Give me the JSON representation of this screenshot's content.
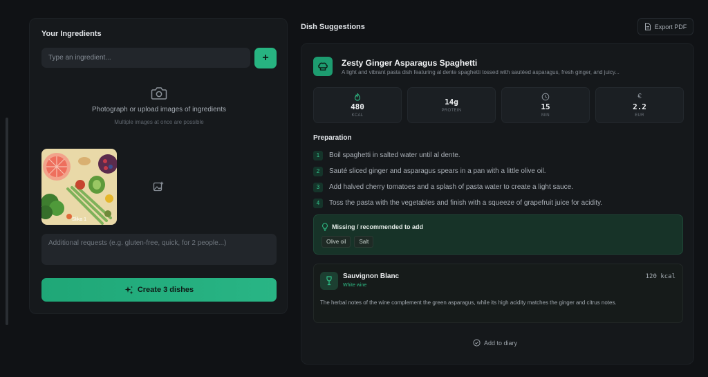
{
  "left": {
    "title": "Your Ingredients",
    "input_placeholder": "Type an ingredient...",
    "add_button": "+",
    "upload_text": "Photograph or upload images of ingredients",
    "upload_subtext": "Multiple images at once are possible",
    "thumbnail_caption": "Slika 1",
    "requests_placeholder": "Additional requests (e.g. gluten-free, quick, for 2 people...)",
    "create_button": "Create 3 dishes"
  },
  "right": {
    "title": "Dish Suggestions",
    "export_button": "Export PDF",
    "dish": {
      "name": "Zesty Ginger Asparagus Spaghetti",
      "description": "A light and vibrant pasta dish featuring al dente spaghetti tossed with sautéed asparagus, fresh ginger, and juicy...",
      "stats": [
        {
          "icon": "flame-icon",
          "value": "480",
          "unit": "KCAL"
        },
        {
          "icon": "",
          "value": "14g",
          "unit": "PROTEIN"
        },
        {
          "icon": "clock-icon",
          "value": "15",
          "unit": "MIN"
        },
        {
          "icon": "euro-icon",
          "value": "2.2",
          "unit": "EUR"
        }
      ],
      "preparation_title": "Preparation",
      "steps": [
        {
          "num": "1",
          "text": "Boil spaghetti in salted water until al dente."
        },
        {
          "num": "2",
          "text": "Sauté sliced ginger and asparagus spears in a pan with a little olive oil."
        },
        {
          "num": "3",
          "text": "Add halved cherry tomatoes and a splash of pasta water to create a light sauce."
        },
        {
          "num": "4",
          "text": "Toss the pasta with the vegetables and finish with a squeeze of grapefruit juice for acidity."
        }
      ],
      "missing_title": "Missing / recommended to add",
      "missing_items": [
        "Olive oil",
        "Salt"
      ],
      "wine": {
        "name": "Sauvignon Blanc",
        "type": "White wine",
        "kcal": "120 kcal",
        "description": "The herbal notes of the wine complement the green asparagus, while its high acidity matches the ginger and citrus notes."
      },
      "diary_button": "Add to diary"
    }
  },
  "colors": {
    "accent": "#27b481",
    "background": "#101215",
    "panel": "#16191c"
  }
}
